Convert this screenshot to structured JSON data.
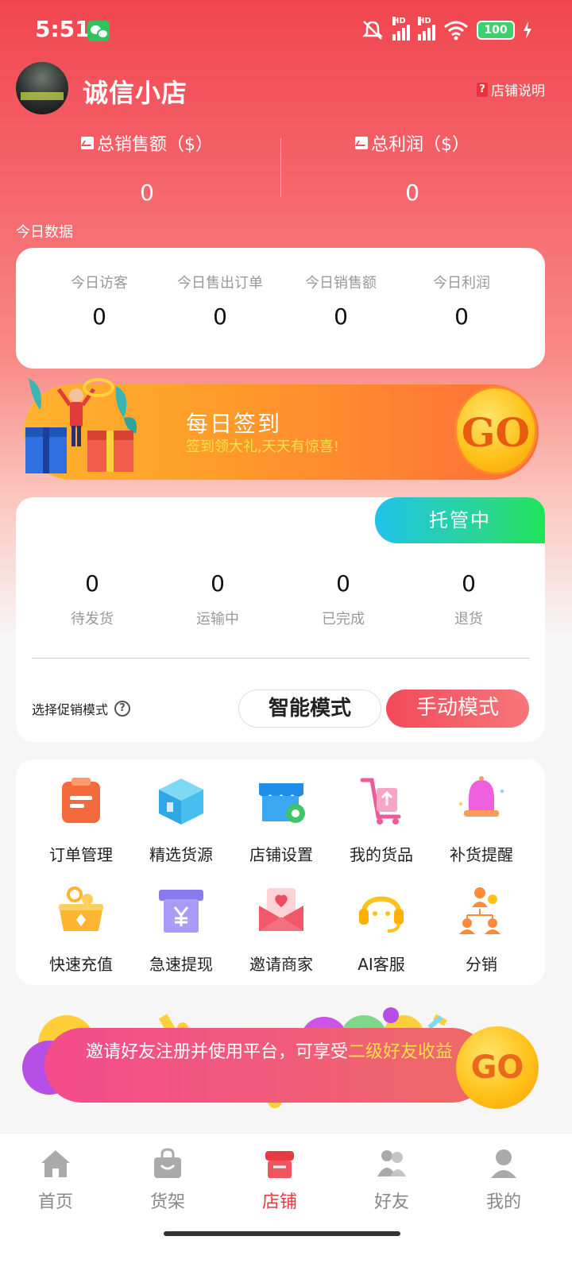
{
  "status_bar": {
    "time": "5:51",
    "battery": "100",
    "hd": "HD"
  },
  "header": {
    "store_name": "诚信小店",
    "help_label": "店铺说明",
    "help_mark": "?"
  },
  "totals": {
    "sales_label": "总销售额（$）",
    "sales_value": "0",
    "profit_label": "总利润（$）",
    "profit_value": "0"
  },
  "today": {
    "title": "今日数据",
    "items": [
      {
        "label": "今日访客",
        "value": "0"
      },
      {
        "label": "今日售出订单",
        "value": "0"
      },
      {
        "label": "今日销售额",
        "value": "0"
      },
      {
        "label": "今日利润",
        "value": "0"
      }
    ]
  },
  "signin": {
    "title": "每日签到",
    "subtitle": "签到领大礼,天天有惊喜!",
    "go": "GO"
  },
  "orders": {
    "badge": "托管中",
    "items": [
      {
        "label": "待发货",
        "value": "0"
      },
      {
        "label": "运输中",
        "value": "0"
      },
      {
        "label": "已完成",
        "value": "0"
      },
      {
        "label": "退货",
        "value": "0"
      }
    ],
    "promo_label": "选择促销模式",
    "help_mark": "?",
    "mode_smart": "智能模式",
    "mode_manual": "手动模式"
  },
  "functions": [
    {
      "label": "订单管理",
      "icon": "clipboard-icon"
    },
    {
      "label": "精选货源",
      "icon": "box-icon"
    },
    {
      "label": "店铺设置",
      "icon": "shop-gear-icon"
    },
    {
      "label": "我的货品",
      "icon": "cart-icon"
    },
    {
      "label": "补货提醒",
      "icon": "bell-icon"
    },
    {
      "label": "快速充值",
      "icon": "coin-bowl-icon"
    },
    {
      "label": "急速提现",
      "icon": "yen-box-icon"
    },
    {
      "label": "邀请商家",
      "icon": "envelope-heart-icon"
    },
    {
      "label": "AI客服",
      "icon": "headset-icon"
    },
    {
      "label": "分销",
      "icon": "people-network-icon"
    }
  ],
  "invite": {
    "text_main": "邀请好友注册并使用平台，可享受",
    "text_highlight": "二级好友收益",
    "go": "GO"
  },
  "nav": [
    {
      "label": "首页",
      "icon": "home-icon"
    },
    {
      "label": "货架",
      "icon": "bag-icon"
    },
    {
      "label": "店铺",
      "icon": "store-icon"
    },
    {
      "label": "好友",
      "icon": "friends-icon"
    },
    {
      "label": "我的",
      "icon": "user-icon"
    }
  ],
  "colors": {
    "accent": "#e83a44",
    "badge_start": "#1fc3e8",
    "badge_end": "#1fe45a",
    "gold": "#ffc21a"
  }
}
